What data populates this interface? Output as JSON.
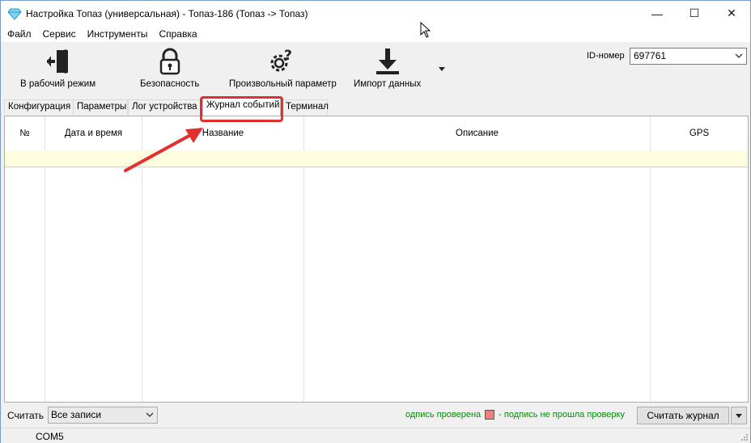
{
  "window": {
    "title": "Настройка Топаз (универсальная) - Топаз-186 (Топаз -> Топаз)",
    "minimize_glyph": "—",
    "maximize_glyph": "☐",
    "close_glyph": "✕"
  },
  "menu": [
    "Файл",
    "Сервис",
    "Инструменты",
    "Справка"
  ],
  "toolbar": {
    "work_mode": "В рабочий режим",
    "security": "Безопасность",
    "custom_param": "Произвольный параметр",
    "import_data": "Импорт данных",
    "id_label": "ID-номер",
    "id_value": "697761"
  },
  "tabs": [
    "Конфигурация",
    "Параметры",
    "Лог устройства",
    "Журнал событий",
    "Терминал"
  ],
  "grid": {
    "columns": [
      "№",
      "Дата и время",
      "Название",
      "Описание",
      "GPS"
    ]
  },
  "bottom": {
    "read_label": "Считать",
    "records_value": "Все записи",
    "legend_ok": "одпись проверена",
    "legend_fail": "- подпись не прошла проверку",
    "read_button": "Считать журнал"
  },
  "status": {
    "port": "COM5"
  },
  "colors": {
    "highlight": "#e03030",
    "row_yellow": "#fffde0",
    "legend_green": "#0a8a0a",
    "legend_square": "#f08080"
  }
}
